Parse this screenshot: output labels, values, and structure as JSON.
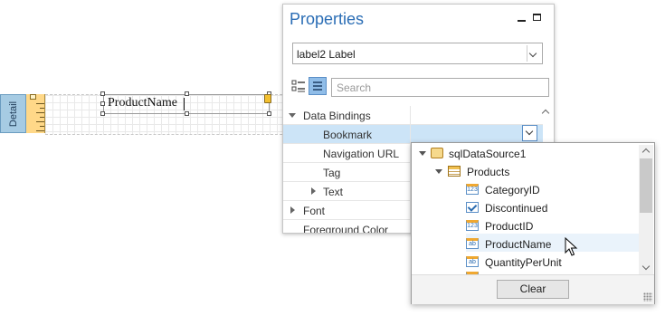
{
  "designer": {
    "band_label": "Detail",
    "label_text": "ProductName"
  },
  "properties": {
    "title": "Properties",
    "selected_object": "label2  Label",
    "search_placeholder": "Search",
    "rows": [
      {
        "name": "Data Bindings",
        "expander": "down"
      },
      {
        "name": "Bookmark",
        "selected": true
      },
      {
        "name": "Navigation URL"
      },
      {
        "name": "Tag"
      },
      {
        "name": "Text",
        "expander": "right"
      },
      {
        "name": "Font",
        "expander": "right"
      },
      {
        "name": "Foreground Color"
      }
    ]
  },
  "dropdown": {
    "tree": [
      {
        "label": "sqlDataSource1",
        "icon": "database-icon",
        "level": 0,
        "expanded": true
      },
      {
        "label": "Products",
        "icon": "table-icon",
        "level": 1,
        "expanded": true
      },
      {
        "label": "CategoryID",
        "icon": "number-field-icon",
        "level": 2
      },
      {
        "label": "Discontinued",
        "icon": "boolean-field-icon",
        "level": 2
      },
      {
        "label": "ProductID",
        "icon": "number-field-icon",
        "level": 2
      },
      {
        "label": "ProductName",
        "icon": "text-field-icon",
        "level": 2,
        "hovered": true
      },
      {
        "label": "QuantityPerUnit",
        "icon": "text-field-icon",
        "level": 2
      }
    ],
    "clear_label": "Clear",
    "num_glyph": "123",
    "text_glyph": "ab"
  }
}
